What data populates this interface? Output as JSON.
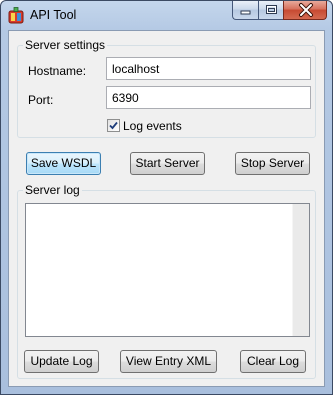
{
  "window": {
    "title": "API Tool",
    "icons": {
      "app": "app-icon",
      "minimize": "minimize-icon",
      "maximize": "maximize-icon",
      "close": "close-icon"
    }
  },
  "server_settings": {
    "title": "Server settings",
    "hostname_label": "Hostname:",
    "hostname_value": "localhost",
    "port_label": "Port:",
    "port_value": "6390",
    "log_events_label": "Log events",
    "log_events_checked": true
  },
  "actions": {
    "save_wsdl": "Save WSDL",
    "start_server": "Start Server",
    "stop_server": "Stop Server"
  },
  "server_log": {
    "title": "Server log",
    "entries": [],
    "update_log": "Update Log",
    "view_entry_xml": "View Entry XML",
    "clear_log": "Clear Log"
  },
  "colors": {
    "title_bar": "#b9cde6",
    "close_button": "#c74a32",
    "client_background": "#f0f0f0",
    "default_button_border": "#3c7fb1"
  }
}
